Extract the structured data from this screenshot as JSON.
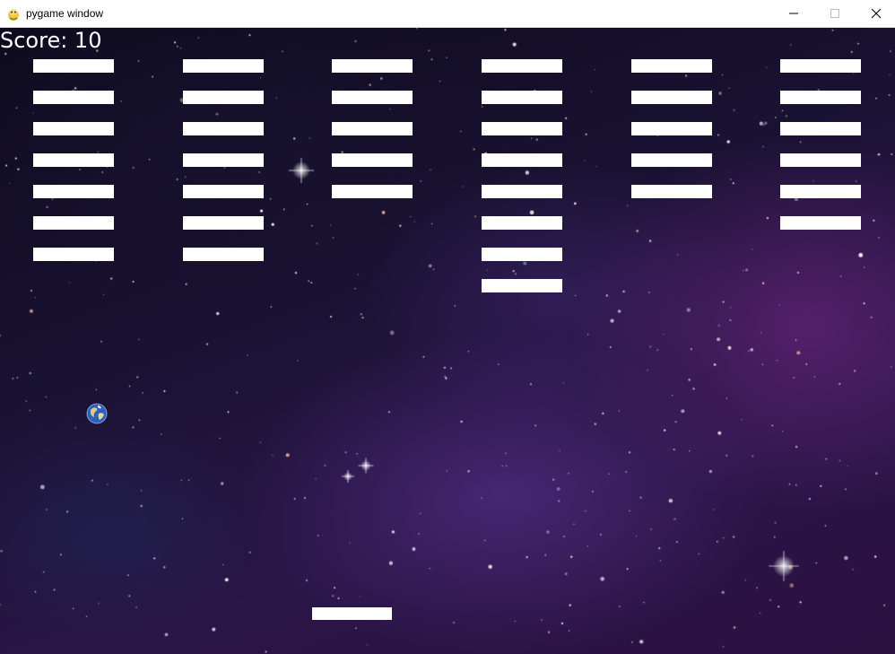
{
  "window": {
    "title": "pygame window",
    "icons": {
      "app": "pygame-snake-icon",
      "minimize": "minimize-icon",
      "maximize": "maximize-icon",
      "close": "close-icon"
    }
  },
  "game": {
    "score_text": "Score: 10",
    "ball_icon": "earth-globe-icon",
    "colors": {
      "brick": "#ffffff",
      "paddle": "#ffffff",
      "text": "#ffffff",
      "background": "#1a1233"
    }
  },
  "bricks": {
    "columns": 6,
    "bricks_per_column": [
      7,
      7,
      5,
      8,
      5,
      6
    ]
  }
}
